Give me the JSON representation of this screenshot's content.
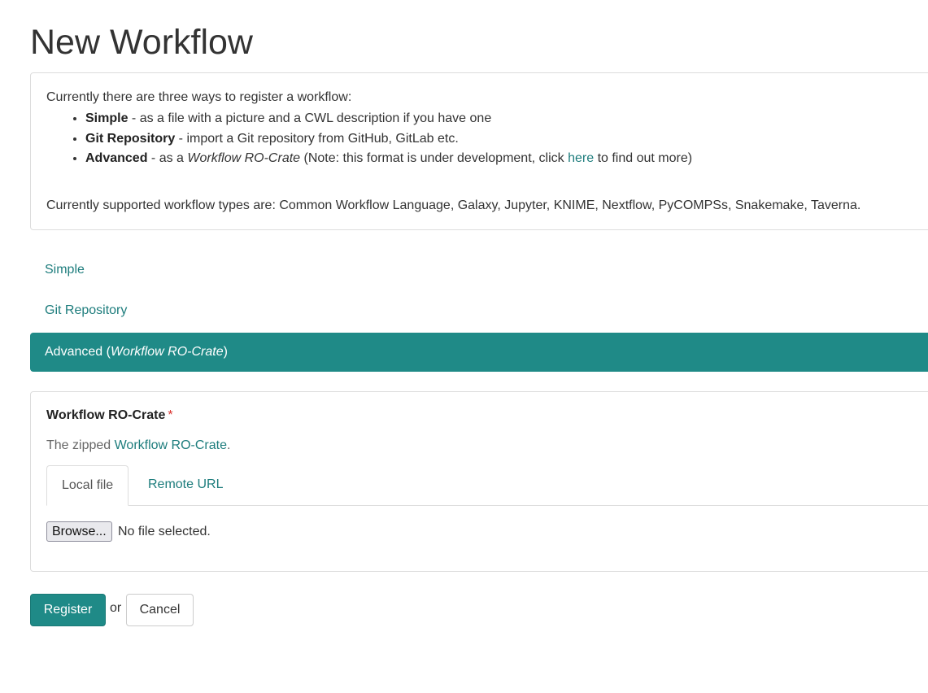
{
  "page": {
    "title": "New Workflow"
  },
  "info": {
    "intro": "Currently there are three ways to register a workflow:",
    "options": [
      {
        "name": "Simple",
        "description": " - as a file with a picture and a CWL description if you have one"
      },
      {
        "name": "Git Repository",
        "description": " - import a Git repository from GitHub, GitLab etc."
      },
      {
        "name": "Advanced",
        "desc_pre": " - as a ",
        "desc_em": "Workflow RO-Crate",
        "desc_mid": " (Note: this format is under development, click ",
        "link": "here",
        "desc_post": " to find out more)"
      }
    ],
    "supported": "Currently supported workflow types are: Common Workflow Language, Galaxy, Jupyter, KNIME, Nextflow, PyCOMPSs, Snakemake, Taverna."
  },
  "nav": {
    "simple": "Simple",
    "git": "Git Repository",
    "advanced_pre": "Advanced (",
    "advanced_em": "Workflow RO-Crate",
    "advanced_post": ")",
    "active": "advanced"
  },
  "form": {
    "label": "Workflow RO-Crate",
    "required": "*",
    "help_pre": "The zipped ",
    "help_link": "Workflow RO-Crate",
    "help_post": ".",
    "tabs": [
      "Local file",
      "Remote URL"
    ],
    "active_tab": "Local file",
    "browse_label": "Browse...",
    "file_status": "No file selected."
  },
  "actions": {
    "register": "Register",
    "or": "or",
    "cancel": "Cancel"
  },
  "colors": {
    "accent": "#1f8a87",
    "link": "#1e7d7d",
    "required": "#d9302b"
  }
}
